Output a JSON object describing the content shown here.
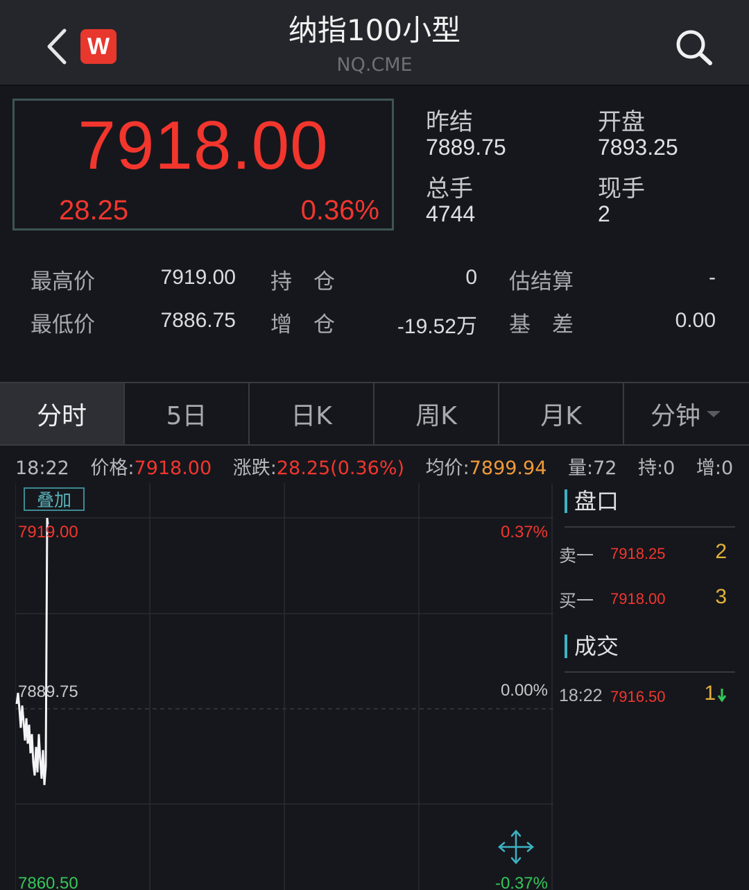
{
  "header": {
    "title": "纳指100小型",
    "subtitle": "NQ.CME",
    "logo_letter": "W",
    "back_icon": "chevron-left-icon",
    "search_icon": "search-icon"
  },
  "quote": {
    "last_price": "7918.00",
    "change": "28.25",
    "change_pct": "0.36%",
    "stats": [
      {
        "label": "昨结",
        "value": "7889.75"
      },
      {
        "label": "开盘",
        "value": "7893.25"
      },
      {
        "label": "总手",
        "value": "4744"
      },
      {
        "label": "现手",
        "value": "2"
      }
    ]
  },
  "details": {
    "rows": [
      [
        {
          "label": "最高价",
          "value": "7919.00"
        },
        {
          "label": "持　仓",
          "value": "0"
        },
        {
          "label": "估结算",
          "value": "-"
        }
      ],
      [
        {
          "label": "最低价",
          "value": "7886.75"
        },
        {
          "label": "增　仓",
          "value": "-19.52万"
        },
        {
          "label": "基　差",
          "value": "0.00"
        }
      ]
    ]
  },
  "tabs": [
    {
      "label": "分时",
      "active": true
    },
    {
      "label": "5日",
      "active": false
    },
    {
      "label": "日K",
      "active": false
    },
    {
      "label": "周K",
      "active": false
    },
    {
      "label": "月K",
      "active": false
    },
    {
      "label": "分钟",
      "active": false
    }
  ],
  "info_line": {
    "time": "18:22",
    "price_label": "价格:",
    "price": "7918.00",
    "change_label": "涨跌:",
    "change": "28.25(0.36%)",
    "avg_label": "均价:",
    "avg": "7899.94",
    "vol_label": "量:",
    "vol": "72",
    "hold_label": "持:",
    "hold": "0",
    "inc_label": "增:",
    "inc": "0"
  },
  "overlay_button": "叠加",
  "chart_data": {
    "type": "line",
    "y_labels_left": [
      "7919.00",
      "7889.75",
      "7860.50"
    ],
    "y_labels_right": [
      "0.37%",
      "0.00%",
      "-0.37%"
    ],
    "ylim": [
      7860.5,
      7919.0
    ],
    "series": [
      {
        "x": [
          0,
          1,
          2,
          3,
          4,
          5,
          6,
          7,
          8,
          9,
          10,
          11,
          12,
          13,
          14,
          15,
          16,
          17,
          18,
          19,
          20,
          21,
          22,
          23
        ],
        "values": [
          7889.75,
          7891.5,
          7889.0,
          7886.0,
          7889.5,
          7887.0,
          7884.0,
          7887.5,
          7883.5,
          7886.5,
          7882.0,
          7885.0,
          7880.5,
          7878.5,
          7883.0,
          7879.0,
          7885.0,
          7881.0,
          7878.0,
          7882.5,
          7877.0,
          7880.0,
          7919.0,
          7918.0
        ]
      }
    ],
    "expand_icon": "expand-arrows-icon"
  },
  "order_book": {
    "title": "盘口",
    "asks": [
      {
        "label": "卖一",
        "price": "7918.25",
        "volume": "2"
      }
    ],
    "bids": [
      {
        "label": "买一",
        "price": "7918.00",
        "volume": "3"
      }
    ]
  },
  "trades": {
    "title": "成交",
    "items": [
      {
        "time": "18:22",
        "price": "7916.50",
        "volume": "1",
        "direction_icon": "arrow-down-icon"
      }
    ]
  },
  "colors": {
    "up": "#f2362e",
    "avg": "#ef9b3a",
    "volume": "#e3b23b",
    "down": "#34c759",
    "accent": "#3db2c4"
  }
}
